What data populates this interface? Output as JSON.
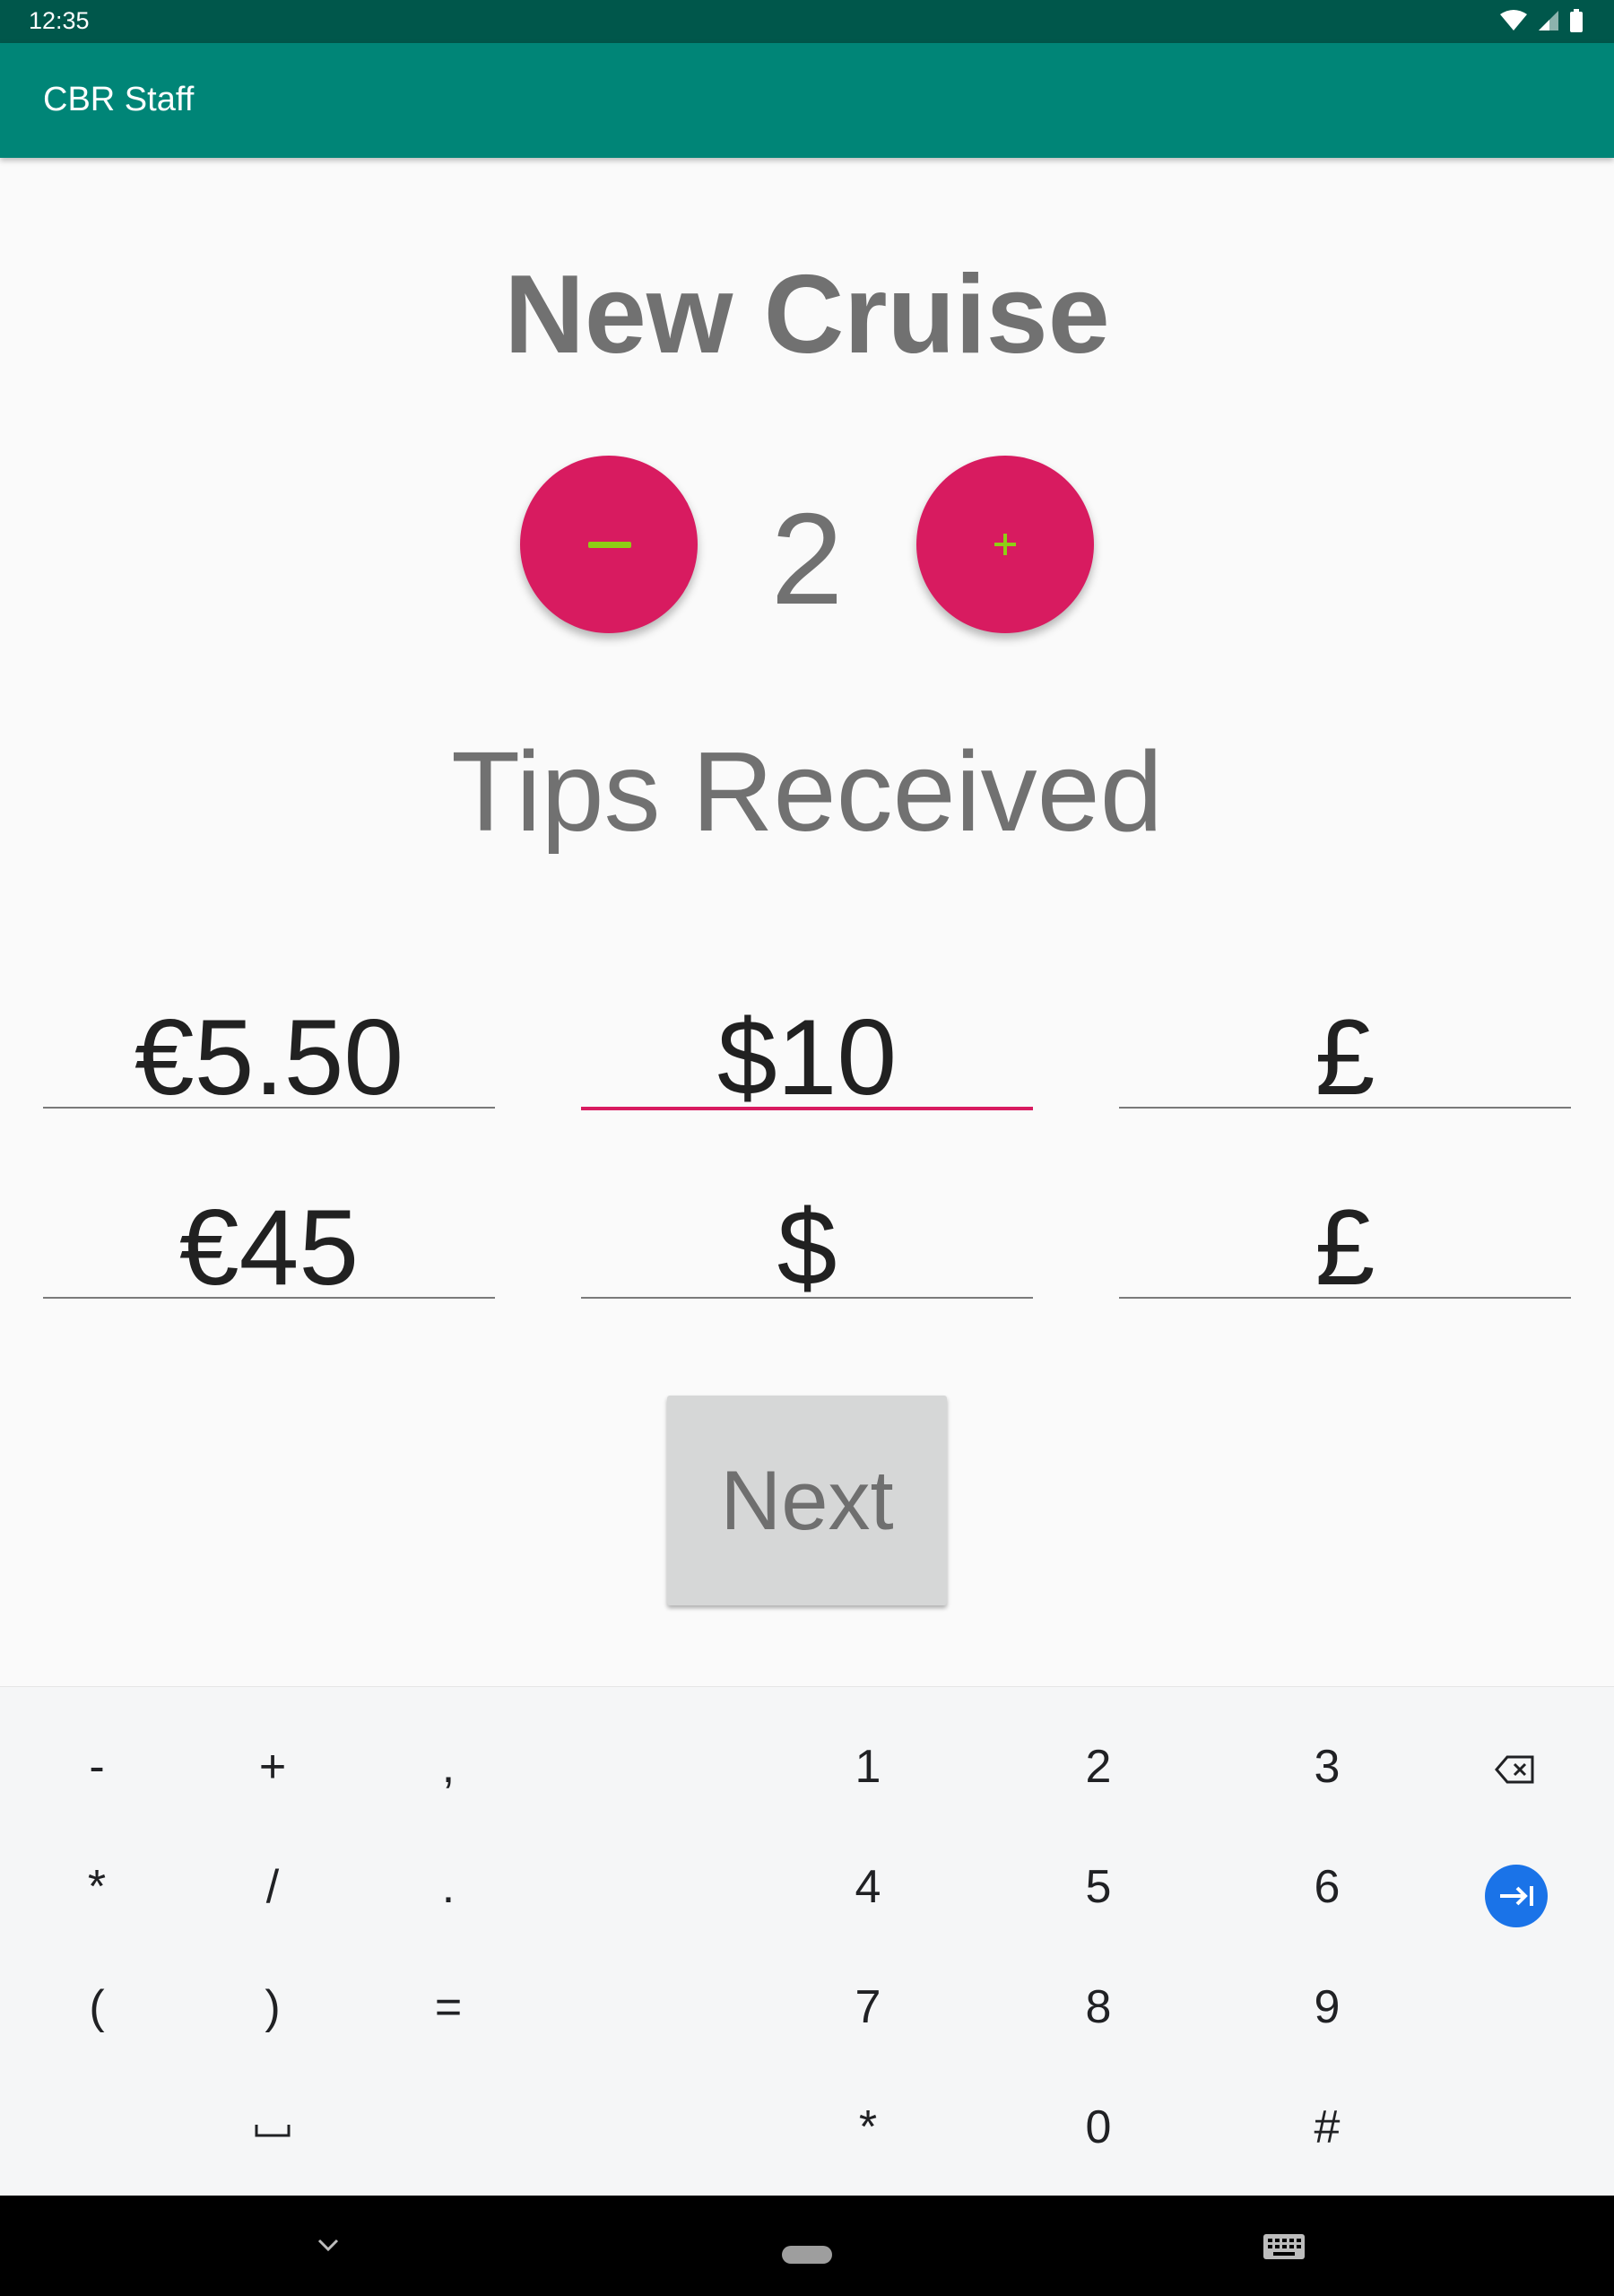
{
  "status_bar": {
    "time": "12:35"
  },
  "app_bar": {
    "title": "CBR Staff"
  },
  "main": {
    "title": "New Cruise",
    "count": "2",
    "minus_label": "−",
    "plus_label": "+",
    "tips_heading": "Tips Received",
    "fields": [
      {
        "value": "€5.50",
        "active": false
      },
      {
        "value": "$10",
        "active": true
      },
      {
        "value": "£",
        "active": false
      },
      {
        "value": "€45",
        "active": false
      },
      {
        "value": "$",
        "active": false
      },
      {
        "value": "£",
        "active": false
      }
    ],
    "next_label": "Next"
  },
  "keyboard": {
    "symbol_keys": [
      [
        "-",
        "+",
        ","
      ],
      [
        "*",
        "/",
        "."
      ],
      [
        "(",
        ")",
        "="
      ],
      [
        "",
        "␣",
        ""
      ]
    ],
    "number_keys": [
      [
        "1",
        "2",
        "3"
      ],
      [
        "4",
        "5",
        "6"
      ],
      [
        "7",
        "8",
        "9"
      ],
      [
        "*",
        "0",
        "#"
      ]
    ]
  },
  "colors": {
    "status_bar": "#00574b",
    "app_bar": "#008577",
    "accent": "#d81b60",
    "icon_green": "#8ecf15",
    "enter_key": "#1a73e8"
  }
}
